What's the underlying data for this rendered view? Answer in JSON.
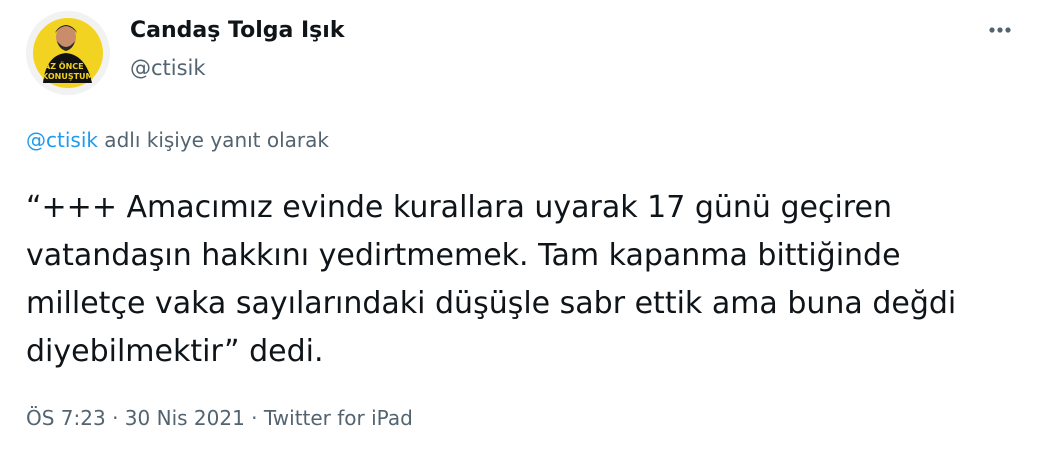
{
  "author": {
    "name": "Candaş Tolga Işık",
    "handle": "@ctisik",
    "avatar_text": "AZ ÖNCE KONUŞTUM"
  },
  "more_icon": "more-horizontal-icon",
  "reply": {
    "mention": "@ctisik",
    "suffix": " adlı kişiye yanıt olarak"
  },
  "tweet": {
    "text": "“+++ Amacımız evinde kurallara uyarak 17 günü geçiren vatandaşın hakkını yedirtmemek. Tam kapanma bittiğinde milletçe vaka sayılarındaki düşüşle sabr ettik ama buna değdi diyebilmektir” dedi."
  },
  "meta": {
    "time": "ÖS 7:23",
    "separator": " · ",
    "date": "30 Nis 2021",
    "source": "Twitter for iPad"
  },
  "colors": {
    "text": "#0f1419",
    "secondary": "#536471",
    "accent": "#1d9bf0",
    "avatar_ring": "#f2d321"
  }
}
